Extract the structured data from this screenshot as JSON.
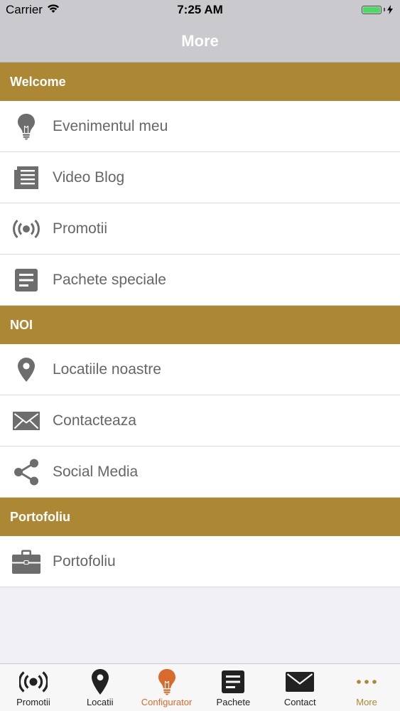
{
  "status_bar": {
    "carrier": "Carrier",
    "time": "7:25 AM"
  },
  "nav": {
    "title": "More"
  },
  "sections": [
    {
      "title": "Welcome",
      "items": [
        {
          "label": "Evenimentul meu",
          "icon": "lightbulb-icon"
        },
        {
          "label": "Video Blog",
          "icon": "newspaper-icon"
        },
        {
          "label": "Promotii",
          "icon": "broadcast-icon"
        },
        {
          "label": "Pachete speciale",
          "icon": "document-icon"
        }
      ]
    },
    {
      "title": "NOI",
      "items": [
        {
          "label": "Locatiile noastre",
          "icon": "map-pin-icon"
        },
        {
          "label": "Contacteaza",
          "icon": "envelope-icon"
        },
        {
          "label": "Social Media",
          "icon": "share-icon"
        }
      ]
    },
    {
      "title": "Portofoliu",
      "items": [
        {
          "label": "Portofoliu",
          "icon": "briefcase-icon"
        }
      ]
    }
  ],
  "tabs": [
    {
      "label": "Promotii",
      "icon": "broadcast-icon"
    },
    {
      "label": "Locatii",
      "icon": "map-pin-icon"
    },
    {
      "label": "Configurator",
      "icon": "lightbulb-icon",
      "active": true
    },
    {
      "label": "Pachete",
      "icon": "document-icon"
    },
    {
      "label": "Contact",
      "icon": "envelope-icon"
    },
    {
      "label": "More",
      "icon": "more-dots-icon"
    }
  ],
  "colors": {
    "accent": "#ac8734",
    "active_tab": "#d86a2c",
    "icon_gray": "#6d6d6d"
  }
}
